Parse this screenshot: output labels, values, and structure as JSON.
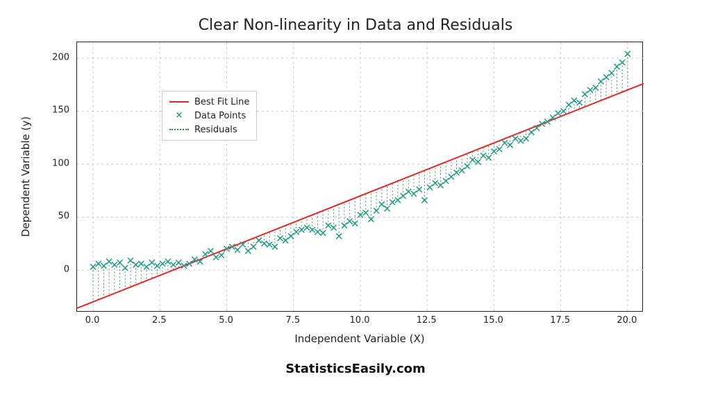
{
  "chart_data": {
    "type": "scatter",
    "title": "Clear Non-linearity in Data and Residuals",
    "xlabel": "Independent Variable (X)",
    "ylabel": "Dependent Variable (y)",
    "xlim": [
      -0.6,
      20.6
    ],
    "ylim": [
      -40,
      215
    ],
    "xticks": [
      0.0,
      2.5,
      5.0,
      7.5,
      10.0,
      12.5,
      15.0,
      17.5,
      20.0
    ],
    "yticks": [
      0,
      50,
      100,
      150,
      200
    ],
    "legend": {
      "position": "upper left",
      "entries": [
        {
          "label": "Best Fit Line",
          "style": "line-red"
        },
        {
          "label": "Data Points",
          "style": "x-teal"
        },
        {
          "label": "Residuals",
          "style": "dots-green"
        }
      ]
    },
    "fit_line": {
      "intercept": -30,
      "slope": 10
    },
    "series": [
      {
        "name": "Data Points",
        "x": [
          0.0,
          0.2,
          0.4,
          0.6,
          0.8,
          1.0,
          1.2,
          1.4,
          1.6,
          1.8,
          2.0,
          2.2,
          2.4,
          2.6,
          2.8,
          3.0,
          3.2,
          3.4,
          3.6,
          3.8,
          4.0,
          4.2,
          4.4,
          4.6,
          4.8,
          5.0,
          5.2,
          5.4,
          5.6,
          5.8,
          6.0,
          6.2,
          6.4,
          6.6,
          6.8,
          7.0,
          7.2,
          7.4,
          7.6,
          7.8,
          8.0,
          8.2,
          8.4,
          8.6,
          8.8,
          9.0,
          9.2,
          9.4,
          9.6,
          9.8,
          10.0,
          10.2,
          10.4,
          10.6,
          10.8,
          11.0,
          11.2,
          11.4,
          11.6,
          11.8,
          12.0,
          12.2,
          12.4,
          12.6,
          12.8,
          13.0,
          13.2,
          13.4,
          13.6,
          13.8,
          14.0,
          14.2,
          14.4,
          14.6,
          14.8,
          15.0,
          15.2,
          15.4,
          15.6,
          15.8,
          16.0,
          16.2,
          16.4,
          16.6,
          16.8,
          17.0,
          17.2,
          17.4,
          17.6,
          17.8,
          18.0,
          18.2,
          18.4,
          18.6,
          18.8,
          19.0,
          19.2,
          19.4,
          19.6,
          19.8,
          20.0
        ],
        "y": [
          3,
          6,
          4,
          8,
          5,
          7,
          2,
          9,
          5,
          6,
          3,
          7,
          4,
          6,
          8,
          5,
          7,
          4,
          6,
          10,
          8,
          15,
          18,
          12,
          14,
          20,
          22,
          19,
          24,
          18,
          22,
          28,
          25,
          24,
          22,
          30,
          28,
          32,
          36,
          38,
          40,
          38,
          36,
          35,
          42,
          40,
          32,
          42,
          46,
          44,
          52,
          54,
          48,
          56,
          62,
          58,
          64,
          66,
          70,
          74,
          72,
          76,
          66,
          78,
          82,
          80,
          84,
          88,
          92,
          94,
          98,
          104,
          102,
          108,
          106,
          112,
          114,
          120,
          118,
          124,
          122,
          124,
          130,
          134,
          138,
          140,
          144,
          148,
          150,
          156,
          160,
          158,
          166,
          170,
          172,
          178,
          182,
          186,
          192,
          196,
          204
        ]
      }
    ]
  },
  "footer": "StatisticsEasily.com"
}
